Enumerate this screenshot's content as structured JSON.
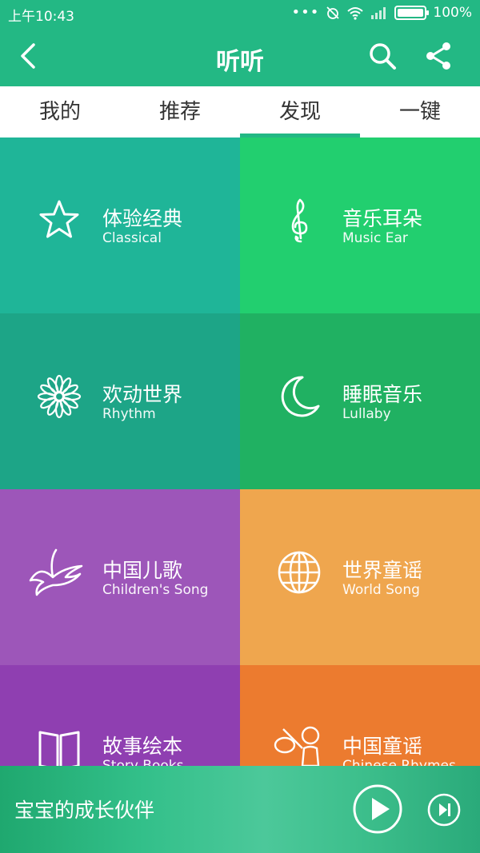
{
  "status_bar": {
    "time": "上午10:43",
    "dots": "•••",
    "battery_percent": "100%",
    "battery_level": 1.0
  },
  "app_bar": {
    "title": "听听",
    "back_icon": "chevron-left-icon",
    "search_icon": "search-icon",
    "share_icon": "share-icon"
  },
  "tabs": [
    {
      "label": "我的"
    },
    {
      "label": "推荐"
    },
    {
      "label": "发现",
      "active": true
    },
    {
      "label": "一键"
    }
  ],
  "tiles": [
    {
      "zh": "体验经典",
      "en": "Classical",
      "icon": "star-icon",
      "color": "#1fb598"
    },
    {
      "zh": "音乐耳朵",
      "en": "Music Ear",
      "icon": "treble-clef-icon",
      "color": "#22cf6f"
    },
    {
      "zh": "欢动世界",
      "en": "Rhythm",
      "icon": "flower-icon",
      "color": "#1da587"
    },
    {
      "zh": "睡眠音乐",
      "en": "Lullaby",
      "icon": "moon-icon",
      "color": "#20b162"
    },
    {
      "zh": "中国儿歌",
      "en": "Children's Song",
      "icon": "swallow-icon",
      "color": "#9d56b9"
    },
    {
      "zh": "世界童谣",
      "en": "World Song",
      "icon": "globe-icon",
      "color": "#efa64e"
    },
    {
      "zh": "故事绘本",
      "en": "Story Books",
      "icon": "book-icon",
      "color": "#8f3fb1"
    },
    {
      "zh": "中国童谣",
      "en": "Chinese Rhymes",
      "icon": "drum-kid-icon",
      "color": "#ec7b2f"
    }
  ],
  "player": {
    "title": "宝宝的成长伙伴",
    "play_icon": "play-icon",
    "next_icon": "skip-next-icon"
  }
}
